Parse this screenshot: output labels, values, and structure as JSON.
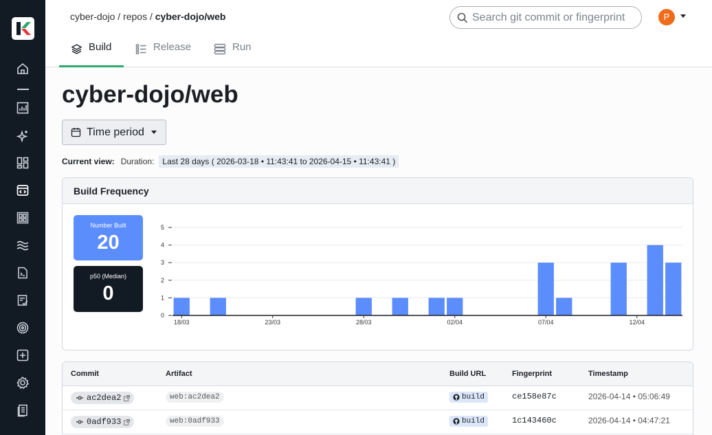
{
  "sidebar": {
    "items": [
      {
        "icon": "home-icon"
      },
      {
        "icon": "bar-chart-icon"
      },
      {
        "icon": "sparkle-icon"
      },
      {
        "icon": "dashboard-icon"
      },
      {
        "icon": "code-window-icon"
      },
      {
        "icon": "grid-icon"
      },
      {
        "icon": "waves-icon"
      },
      {
        "icon": "terminal-file-icon"
      },
      {
        "icon": "checklist-icon"
      },
      {
        "icon": "target-icon"
      },
      {
        "icon": "plus-box-icon"
      },
      {
        "icon": "gear-icon"
      },
      {
        "icon": "document-icon"
      }
    ]
  },
  "header": {
    "breadcrumb": {
      "part1": "cyber-dojo",
      "sep1": " / ",
      "part2": "repos",
      "sep2": " / ",
      "current": "cyber-dojo/web"
    },
    "search_placeholder": "Search git commit or fingerprint",
    "avatar_letter": "P",
    "tabs": [
      {
        "label": "Build",
        "active": true
      },
      {
        "label": "Release",
        "active": false
      },
      {
        "label": "Run",
        "active": false
      }
    ]
  },
  "page": {
    "title": "cyber-dojo/web",
    "time_period_label": "Time period",
    "current_view_label": "Current view:",
    "duration_label": "Duration:",
    "duration_value": "Last 28 days ( 2026-03-18 • 11:43:41 to 2026-04-15 • 11:43:41 )"
  },
  "build_frequency": {
    "title": "Build Frequency",
    "number_built_label": "Number Built",
    "number_built_value": "20",
    "median_label": "p50 (Median)",
    "median_value": "0"
  },
  "chart_data": {
    "type": "bar",
    "title": "",
    "xlabel": "",
    "ylabel": "",
    "ylim": [
      0,
      5
    ],
    "yticks": [
      0,
      1,
      2,
      3,
      4,
      5
    ],
    "grid": true,
    "xtick_labels": [
      "18/03",
      "23/03",
      "28/03",
      "02/04",
      "07/04",
      "12/04"
    ],
    "categories": [
      "18/03",
      "19/03",
      "20/03",
      "21/03",
      "22/03",
      "23/03",
      "24/03",
      "25/03",
      "26/03",
      "27/03",
      "28/03",
      "29/03",
      "30/03",
      "31/03",
      "01/04",
      "02/04",
      "03/04",
      "04/04",
      "05/04",
      "06/04",
      "07/04",
      "08/04",
      "09/04",
      "10/04",
      "11/04",
      "12/04",
      "13/04",
      "14/04"
    ],
    "values": [
      1,
      0,
      1,
      0,
      0,
      0,
      0,
      0,
      0,
      0,
      1,
      0,
      1,
      0,
      1,
      1,
      0,
      0,
      0,
      0,
      3,
      1,
      0,
      0,
      3,
      0,
      4,
      3
    ],
    "color": "#5c8dfc"
  },
  "table": {
    "headers": {
      "commit": "Commit",
      "artifact": "Artifact",
      "build_url": "Build URL",
      "fingerprint": "Fingerprint",
      "timestamp": "Timestamp"
    },
    "rows": [
      {
        "commit": "ac2dea2",
        "artifact": "web:ac2dea2",
        "build": "build",
        "fingerprint": "ce158e87c",
        "timestamp": "2026-04-14 • 05:06:49"
      },
      {
        "commit": "0adf933",
        "artifact": "web:0adf933",
        "build": "build",
        "fingerprint": "1c143460c",
        "timestamp": "2026-04-14 • 04:47:21"
      }
    ]
  }
}
